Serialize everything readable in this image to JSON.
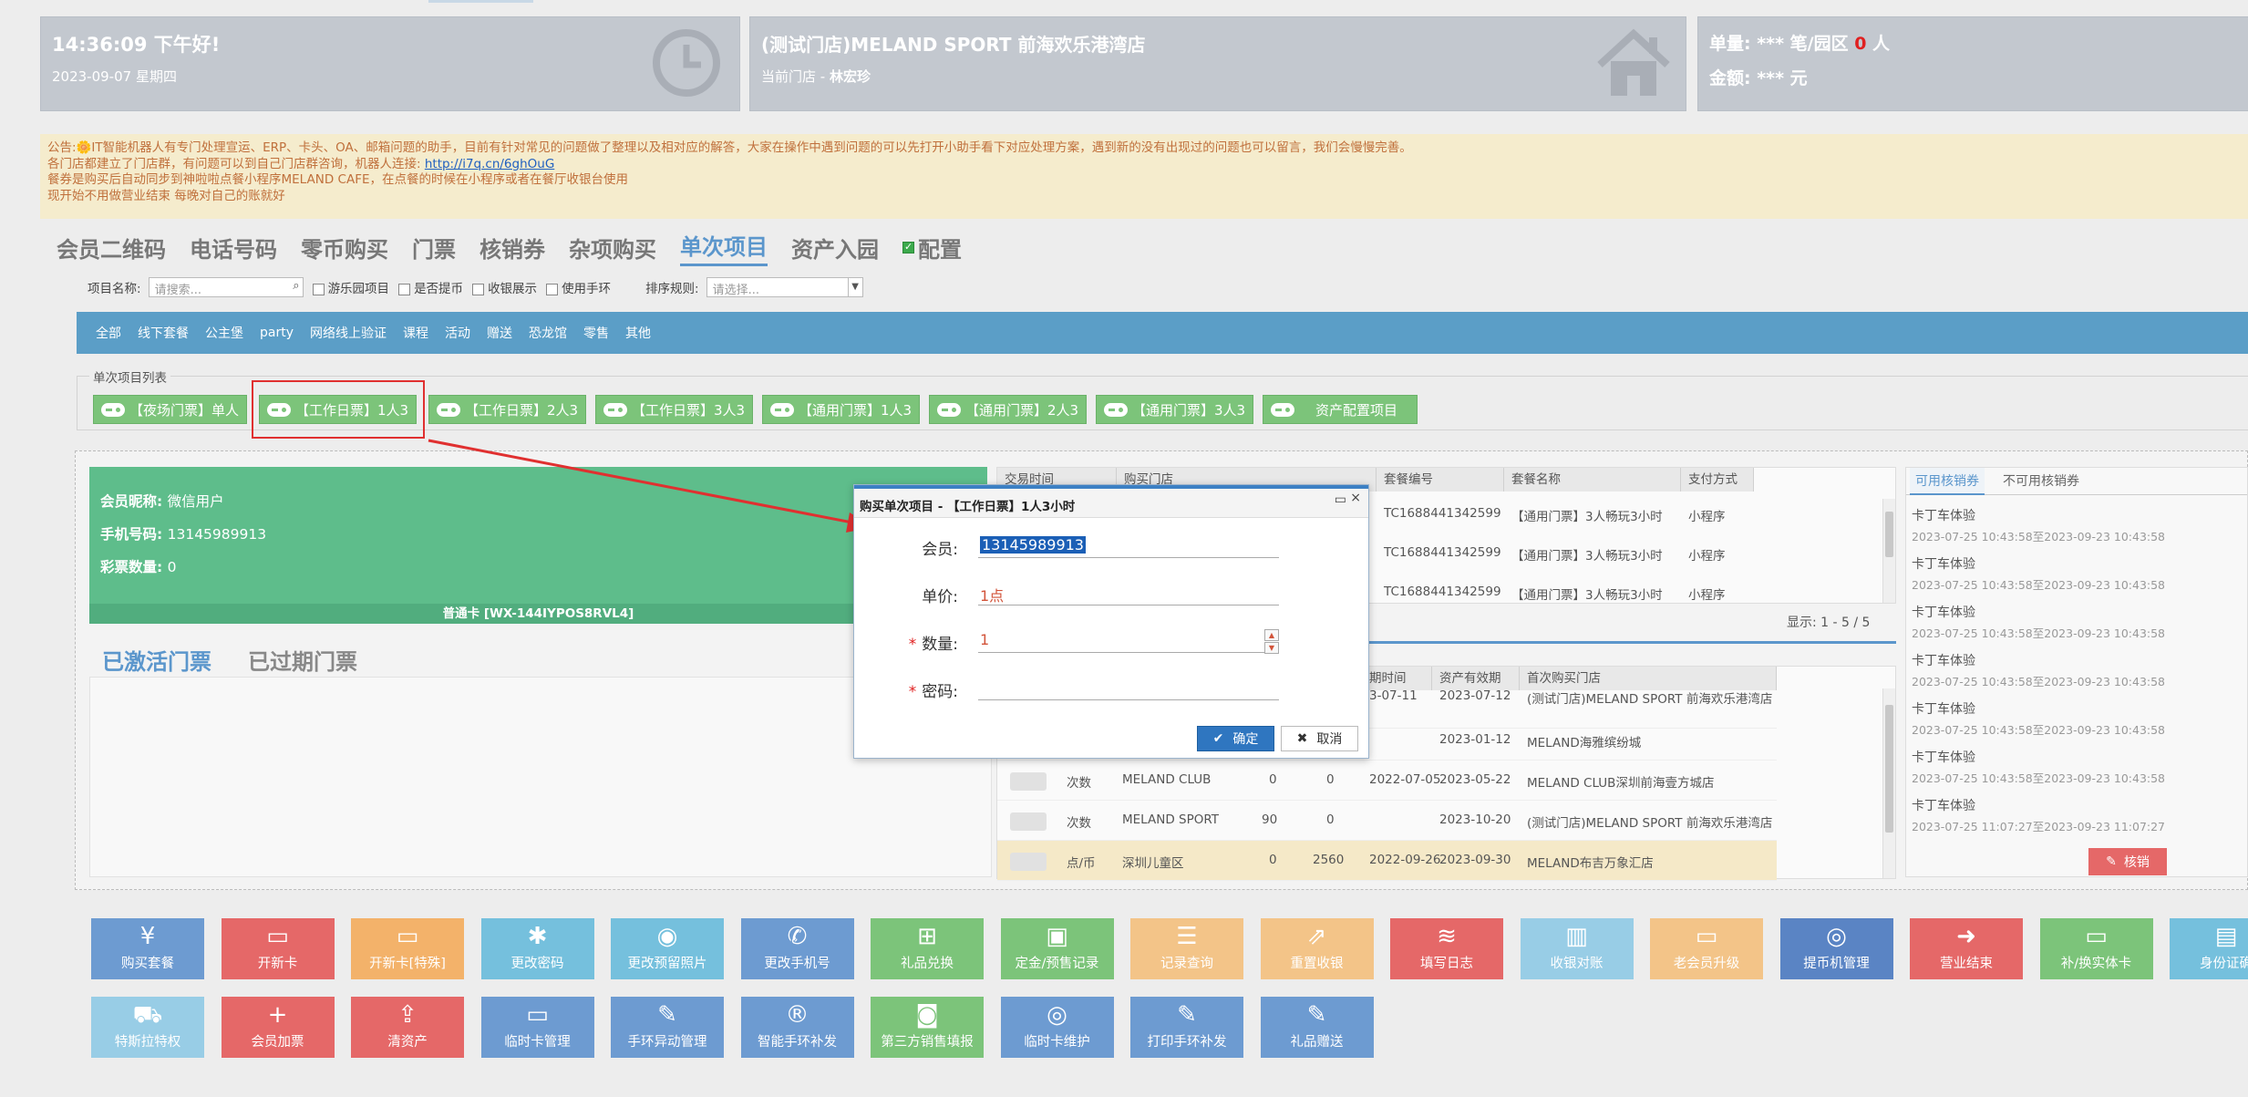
{
  "header": {
    "time_greeting": "14:36:09 下午好!",
    "date": "2023-09-07 星期四",
    "store_name": "(测试门店)MELAND SPORT 前海欢乐港湾店",
    "current_store_label": "当前门店 - ",
    "current_store_user": "林宏珍",
    "stat_orders_prefix": "单量: *** 笔/园区 ",
    "stat_orders_count": "0",
    "stat_orders_suffix": " 人",
    "stat_amount": "金额: *** 元"
  },
  "notice": {
    "line1": "公告:🌼IT智能机器人有专门处理宣运、ERP、卡头、OA、邮箱问题的助手，目前有针对常见的问题做了整理以及相对应的解答，大家在操作中遇到问题的可以先打开小助手看下对应处理方案，遇到新的没有出现过的问题也可以留言，我们会慢慢完善。",
    "line2_prefix": "各门店都建立了门店群，有问题可以到自己门店群咨询，机器人连接: ",
    "line2_link": "http://i7q.cn/6ghOuG",
    "line3": "餐券是购买后自动同步到神啦啦点餐小程序MELAND CAFE，在点餐的时候在小程序或者在餐厅收银台使用",
    "line4": "现开始不用做营业结束 每晚对自己的账就好"
  },
  "main_tabs": [
    "会员二维码",
    "电话号码",
    "零币购买",
    "门票",
    "核销券",
    "杂项购买",
    "单次项目",
    "资产入园"
  ],
  "config_label": "配置",
  "filter": {
    "item_name_label": "项目名称:",
    "search_placeholder": "请搜索...",
    "cb_park": "游乐园项目",
    "cb_coin": "是否提币",
    "cb_cashier": "收银展示",
    "cb_band": "使用手环",
    "sort_label": "排序规则:",
    "sort_placeholder": "请选择..."
  },
  "categories": [
    "全部",
    "线下套餐",
    "公主堡",
    "party",
    "网络线上验证",
    "课程",
    "活动",
    "赠送",
    "恐龙馆",
    "零售",
    "其他"
  ],
  "item_list_legend": "单次项目列表",
  "items": [
    "【夜场门票】单人",
    "【工作日票】1人3",
    "【工作日票】2人3",
    "【工作日票】3人3",
    "【通用门票】1人3",
    "【通用门票】2人3",
    "【通用门票】3人3",
    "资产配置项目"
  ],
  "member": {
    "nickname_label": "会员昵称:",
    "nickname": "微信用户",
    "phone_label": "手机号码:",
    "phone": "13145989913",
    "lottery_label": "彩票数量:",
    "lottery": "0",
    "card": "普通卡 [WX-144IYPOS8RVL4]"
  },
  "ticket_tabs": [
    "已激活门票",
    "已过期门票"
  ],
  "grid1": {
    "headers": [
      "交易时间",
      "购买门店",
      "套餐编号",
      "套餐名称",
      "支付方式"
    ],
    "rows": [
      {
        "code": "TC1688441342599",
        "name": "【通用门票】3人畅玩3小时",
        "pay": "小程序"
      },
      {
        "code": "TC1688441342599",
        "name": "【通用门票】3人畅玩3小时",
        "pay": "小程序"
      },
      {
        "code": "TC1688441342599",
        "name": "【通用门票】3人畅玩3小时",
        "pay": "小程序"
      }
    ],
    "pager": "显示: 1 - 5 / 5"
  },
  "grid2": {
    "headers": [
      "期时间",
      "资产有效期",
      "首次购买门店"
    ],
    "rows": [
      {
        "type": "",
        "brand": "",
        "a": "",
        "b": "",
        "start": "3-07-11",
        "expire": "2023-07-12",
        "store": "(测试门店)MELAND SPORT 前海欢乐港湾店"
      },
      {
        "type": "",
        "brand": "",
        "a": "",
        "b": "",
        "start": "",
        "expire": "2023-01-12",
        "store": "MELAND海雅缤纷城"
      },
      {
        "type": "次数",
        "brand": "MELAND CLUB",
        "a": "0",
        "b": "0",
        "start": "2022-07-05",
        "expire": "2023-05-22",
        "store": "MELAND CLUB深圳前海壹方城店"
      },
      {
        "type": "次数",
        "brand": "MELAND SPORT",
        "a": "90",
        "b": "0",
        "start": "",
        "expire": "2023-10-20",
        "store": "(测试门店)MELAND SPORT 前海欢乐港湾店"
      },
      {
        "type": "点/币",
        "brand": "深圳儿童区",
        "a": "0",
        "b": "2560",
        "start": "2022-09-26",
        "expire": "2023-09-30",
        "store": "MELAND布吉万象汇店"
      }
    ]
  },
  "coupons": {
    "tabs": [
      "可用核销券",
      "不可用核销券"
    ],
    "items": [
      {
        "name": "卡丁车体验",
        "date": "2023-07-25 10:43:58至2023-09-23 10:43:58"
      },
      {
        "name": "卡丁车体验",
        "date": "2023-07-25 10:43:58至2023-09-23 10:43:58"
      },
      {
        "name": "卡丁车体验",
        "date": "2023-07-25 10:43:58至2023-09-23 10:43:58"
      },
      {
        "name": "卡丁车体验",
        "date": "2023-07-25 10:43:58至2023-09-23 10:43:58"
      },
      {
        "name": "卡丁车体验",
        "date": "2023-07-25 10:43:58至2023-09-23 10:43:58"
      },
      {
        "name": "卡丁车体验",
        "date": "2023-07-25 10:43:58至2023-09-23 10:43:58"
      },
      {
        "name": "卡丁车体验",
        "date": "2023-07-25 11:07:27至2023-09-23 11:07:27"
      }
    ],
    "redeem_label": "核销"
  },
  "toolbar_row1": [
    {
      "label": "购买套餐",
      "icon": "¥",
      "color": "blue"
    },
    {
      "label": "开新卡",
      "icon": "▭",
      "color": "red"
    },
    {
      "label": "开新卡[特殊]",
      "icon": "▭",
      "color": "orange"
    },
    {
      "label": "更改密码",
      "icon": "✱",
      "color": "cyan"
    },
    {
      "label": "更改预留照片",
      "icon": "◉",
      "color": "cyan"
    },
    {
      "label": "更改手机号",
      "icon": "✆",
      "color": "blue"
    },
    {
      "label": "礼品兑换",
      "icon": "⊞",
      "color": "green"
    },
    {
      "label": "定金/预售记录",
      "icon": "▣",
      "color": "green"
    },
    {
      "label": "记录查询",
      "icon": "☰",
      "color": "lorange"
    },
    {
      "label": "重置收银",
      "icon": "⇗",
      "color": "lorange"
    },
    {
      "label": "填写日志",
      "icon": "≋",
      "color": "red"
    },
    {
      "label": "收银对账",
      "icon": "▥",
      "color": "lblue"
    },
    {
      "label": "老会员升级",
      "icon": "▭",
      "color": "lorange"
    },
    {
      "label": "提币机管理",
      "icon": "◎",
      "color": "dblue"
    },
    {
      "label": "营业结束",
      "icon": "➜",
      "color": "red"
    },
    {
      "label": "补/换实体卡",
      "icon": "▭",
      "color": "green"
    },
    {
      "label": "身份证确",
      "icon": "▤",
      "color": "cyan"
    }
  ],
  "toolbar_row2": [
    {
      "label": "特斯拉特权",
      "icon": "⛟",
      "color": "lblue"
    },
    {
      "label": "会员加票",
      "icon": "+",
      "color": "red"
    },
    {
      "label": "清资产",
      "icon": "⇪",
      "color": "red"
    },
    {
      "label": "临时卡管理",
      "icon": "▭",
      "color": "blue"
    },
    {
      "label": "手环异动管理",
      "icon": "✎",
      "color": "blue"
    },
    {
      "label": "智能手环补发",
      "icon": "®",
      "color": "blue"
    },
    {
      "label": "第三方销售填报",
      "icon": "◙",
      "color": "green"
    },
    {
      "label": "临时卡维护",
      "icon": "◎",
      "color": "blue"
    },
    {
      "label": "打印手环补发",
      "icon": "✎",
      "color": "blue"
    },
    {
      "label": "礼品赠送",
      "icon": "✎",
      "color": "blue"
    }
  ],
  "dialog": {
    "title": "购买单次项目 - 【工作日票】1人3小时",
    "member_label": "会员:",
    "member_value": "13145989913",
    "price_label": "单价:",
    "price_value": "1点",
    "qty_label": "数量:",
    "qty_value": "1",
    "pwd_label": "密码:",
    "ok_label": "确定",
    "cancel_label": "取消"
  },
  "colors": {
    "blue": "#6d9bd1",
    "red": "#e56868",
    "orange": "#f3b26a",
    "cyan": "#75c0dd",
    "green": "#7cc47a",
    "lorange": "#f3c488",
    "lblue": "#98cde6",
    "dblue": "#5a84c4",
    "arrow": "#e03030"
  }
}
